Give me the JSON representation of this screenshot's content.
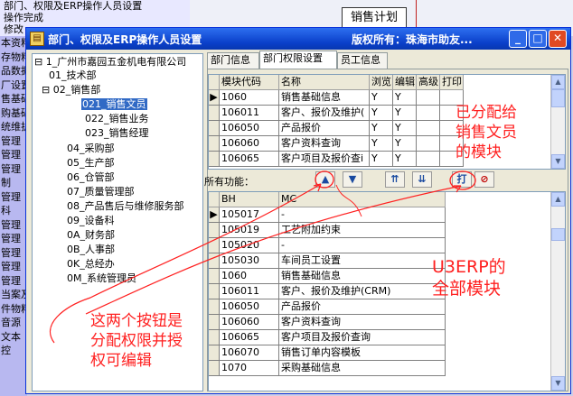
{
  "background_app": {
    "menu_items": [
      "部门、权限及ERP操作人员设置",
      "操作完成",
      "修改"
    ],
    "left_items": [
      "本资料",
      "存物料",
      "品数据",
      "厂设置",
      "售基础",
      "购基础",
      "统维护",
      "管理",
      "管理",
      "管理",
      "制",
      "管理",
      "科",
      "管理",
      "管理",
      "管理",
      "管理",
      "管理",
      "当案及",
      "件物料",
      "音源",
      "文本",
      "控"
    ],
    "flow_box": "销售计划"
  },
  "window": {
    "title": "部门、权限及ERP操作人员设置",
    "copyright": "版权所有：珠海市助友...",
    "buttons": {
      "minimize": "_",
      "maximize": "□",
      "close": "✕"
    }
  },
  "tree": {
    "root": "1_广州市嘉园五金机电有限公司",
    "nodes": [
      "01_技术部",
      "02_销售部",
      "021_销售文员",
      "022_销售业务",
      "023_销售经理",
      "04_采购部",
      "05_生产部",
      "06_仓管部",
      "07_质量管理部",
      "08_产品售后与维修服务部",
      "09_设备科",
      "0A_财务部",
      "0B_人事部",
      "0K_总经办",
      "0M_系统管理员"
    ]
  },
  "tabs": [
    "部门信息",
    "部门权限设置",
    "员工信息"
  ],
  "top_grid": {
    "headers": [
      "模块代码",
      "名称",
      "浏览",
      "编辑",
      "高级",
      "打印"
    ],
    "rows": [
      [
        "1060",
        "销售基础信息",
        "Y",
        "Y",
        "",
        ""
      ],
      [
        "106011",
        "客户、报价及维护(",
        "Y",
        "Y",
        "",
        ""
      ],
      [
        "106050",
        "产品报价",
        "Y",
        "Y",
        "",
        ""
      ],
      [
        "106060",
        "客户资料查询",
        "Y",
        "Y",
        "",
        ""
      ],
      [
        "106065",
        "客户项目及报价查i",
        "Y",
        "Y",
        "",
        ""
      ]
    ]
  },
  "toolbar": {
    "label": "所有功能：",
    "buttons": [
      "▲",
      "▼",
      "⇈",
      "⇊",
      "打",
      "⊘"
    ]
  },
  "bottom_grid": {
    "headers": [
      "BH",
      "MC"
    ],
    "rows": [
      [
        "105017",
        "-"
      ],
      [
        "105019",
        "工艺附加约束"
      ],
      [
        "105020",
        "-"
      ],
      [
        "105030",
        "车间员工设置"
      ],
      [
        "1060",
        "销售基础信息"
      ],
      [
        "106011",
        "客户、报价及维护(CRM)"
      ],
      [
        "106050",
        "产品报价"
      ],
      [
        "106060",
        "客户资料查询"
      ],
      [
        "106065",
        "客户项目及报价查询"
      ],
      [
        "106070",
        "销售订单内容模板"
      ],
      [
        "1070",
        "采购基础信息"
      ]
    ]
  },
  "annotations": {
    "assigned": [
      "已分配给",
      "销售文员",
      "的模块"
    ],
    "all_modules": [
      "U3ERP的",
      "全部模块"
    ],
    "buttons_note": [
      "这两个按钮是",
      "分配权限并授",
      "权可编辑"
    ]
  },
  "colors": {
    "annotation": "#ff2020",
    "selection": "#316ac5",
    "title_bar": "#0a3fc9"
  }
}
